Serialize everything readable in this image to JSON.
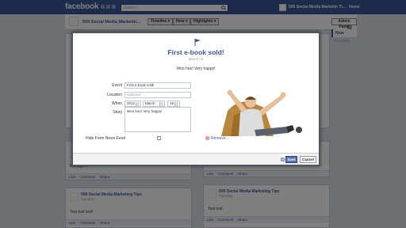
{
  "topbar": {
    "logo": "facebook",
    "search_placeholder": "Search",
    "page_name": "500 Social Media Marketin Ti...",
    "home": "Home"
  },
  "header": {
    "page_title": "500 Social Media Marketin...",
    "timeline": "Timeline",
    "now": "Now",
    "highlights": "Highlights",
    "admin_panel": "Admin Panel"
  },
  "timeline_nav": {
    "now": "Now",
    "founded": "Founded"
  },
  "posts": {
    "left_middle": {
      "text": "Managem",
      "like": "Like",
      "comment": "Comment",
      "share": "Share"
    },
    "left_bottom": {
      "name": "500 Social Media Marketing Tips",
      "time": "Tuesday",
      "text": "Test test test!",
      "like": "Like",
      "comment": "Comment",
      "share": "Share"
    },
    "right_middle": {
      "like": "Like",
      "comment": "Comment",
      "share": "Share"
    },
    "right_bottom": {
      "name": "500 Social Media Marketing Tips",
      "time": "Tuesday",
      "text": "Test test",
      "like": "Like",
      "comment": "Comment",
      "share": "Share"
    }
  },
  "dialog": {
    "title": "First e-book sold!",
    "date": "March 18",
    "subtitle": "Woo hoo! Very happy!",
    "event_label": "Event",
    "event_value": "First e-book sold!",
    "location_label": "Location",
    "location_placeholder": "Optional",
    "when_label": "When",
    "year": "2012",
    "month": "March",
    "day": "18",
    "story_label": "Story",
    "story_value": "Woo hoo! Very happy!",
    "hide_label": "Hide From News Feed",
    "hide_checked": false,
    "remove": "Remove...",
    "save": "Save",
    "cancel": "Cancel"
  },
  "colors": {
    "facebook_blue": "#3b5998",
    "save_button": "#5b74a8",
    "page_background": "#dbdee6"
  }
}
